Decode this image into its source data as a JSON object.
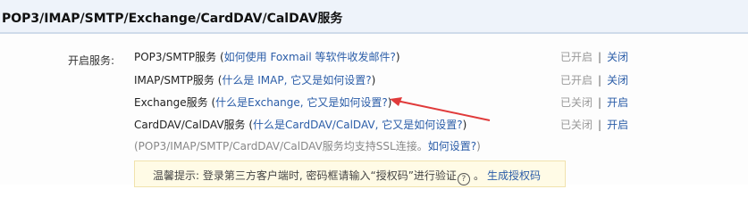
{
  "header": {
    "title": "POP3/IMAP/SMTP/Exchange/CardDAV/CalDAV服务"
  },
  "services": {
    "label": "开启服务:",
    "items": [
      {
        "name": "POP3/SMTP服务",
        "open_paren": " (",
        "link": "如何使用 Foxmail 等软件收发邮件?",
        "close_paren": ")",
        "status": "已开启",
        "action": "关闭"
      },
      {
        "name": "IMAP/SMTP服务",
        "open_paren": " (",
        "link": "什么是 IMAP, 它又是如何设置?",
        "close_paren": ")",
        "status": "已开启",
        "action": "关闭"
      },
      {
        "name": "Exchange服务",
        "open_paren": " (",
        "link": "什么是Exchange, 它又是如何设置?",
        "close_paren": ")",
        "status": "已关闭",
        "action": "开启"
      },
      {
        "name": "CardDAV/CalDAV服务",
        "open_paren": " (",
        "link": "什么是CardDAV/CalDAV, 它又是如何设置?",
        "close_paren": ")",
        "status": "已关闭",
        "action": "开启"
      }
    ],
    "separator": "|",
    "ssl_note": "(POP3/IMAP/SMTP/CardDAV/CalDAV服务均支持SSL连接。",
    "ssl_link": "如何设置?",
    "ssl_note_end": ")"
  },
  "tip": {
    "text": "温馨提示: 登录第三方客户端时, 密码框请输入“授权码”进行验证",
    "help_icon": "?",
    "link": "生成授权码"
  },
  "colors": {
    "header_bg": "#eef3fa",
    "link": "#2b5da8",
    "status": "#999999",
    "arrow": "#e03a3a",
    "tip_bg": "#fffbe6"
  }
}
